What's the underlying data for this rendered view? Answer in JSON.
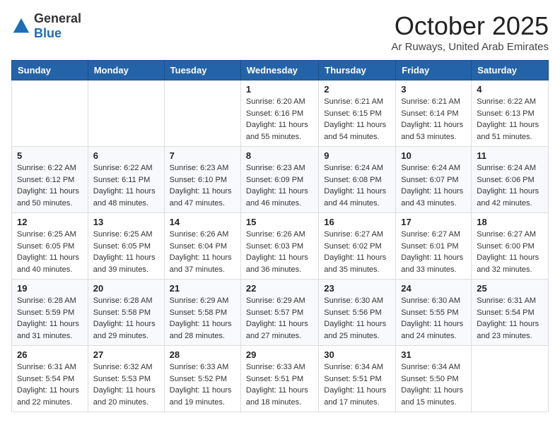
{
  "header": {
    "logo_general": "General",
    "logo_blue": "Blue",
    "month_title": "October 2025",
    "subtitle": "Ar Ruways, United Arab Emirates"
  },
  "weekdays": [
    "Sunday",
    "Monday",
    "Tuesday",
    "Wednesday",
    "Thursday",
    "Friday",
    "Saturday"
  ],
  "weeks": [
    [
      {
        "day": "",
        "sunrise": "",
        "sunset": "",
        "daylight": ""
      },
      {
        "day": "",
        "sunrise": "",
        "sunset": "",
        "daylight": ""
      },
      {
        "day": "",
        "sunrise": "",
        "sunset": "",
        "daylight": ""
      },
      {
        "day": "1",
        "sunrise": "Sunrise: 6:20 AM",
        "sunset": "Sunset: 6:16 PM",
        "daylight": "Daylight: 11 hours and 55 minutes."
      },
      {
        "day": "2",
        "sunrise": "Sunrise: 6:21 AM",
        "sunset": "Sunset: 6:15 PM",
        "daylight": "Daylight: 11 hours and 54 minutes."
      },
      {
        "day": "3",
        "sunrise": "Sunrise: 6:21 AM",
        "sunset": "Sunset: 6:14 PM",
        "daylight": "Daylight: 11 hours and 53 minutes."
      },
      {
        "day": "4",
        "sunrise": "Sunrise: 6:22 AM",
        "sunset": "Sunset: 6:13 PM",
        "daylight": "Daylight: 11 hours and 51 minutes."
      }
    ],
    [
      {
        "day": "5",
        "sunrise": "Sunrise: 6:22 AM",
        "sunset": "Sunset: 6:12 PM",
        "daylight": "Daylight: 11 hours and 50 minutes."
      },
      {
        "day": "6",
        "sunrise": "Sunrise: 6:22 AM",
        "sunset": "Sunset: 6:11 PM",
        "daylight": "Daylight: 11 hours and 48 minutes."
      },
      {
        "day": "7",
        "sunrise": "Sunrise: 6:23 AM",
        "sunset": "Sunset: 6:10 PM",
        "daylight": "Daylight: 11 hours and 47 minutes."
      },
      {
        "day": "8",
        "sunrise": "Sunrise: 6:23 AM",
        "sunset": "Sunset: 6:09 PM",
        "daylight": "Daylight: 11 hours and 46 minutes."
      },
      {
        "day": "9",
        "sunrise": "Sunrise: 6:24 AM",
        "sunset": "Sunset: 6:08 PM",
        "daylight": "Daylight: 11 hours and 44 minutes."
      },
      {
        "day": "10",
        "sunrise": "Sunrise: 6:24 AM",
        "sunset": "Sunset: 6:07 PM",
        "daylight": "Daylight: 11 hours and 43 minutes."
      },
      {
        "day": "11",
        "sunrise": "Sunrise: 6:24 AM",
        "sunset": "Sunset: 6:06 PM",
        "daylight": "Daylight: 11 hours and 42 minutes."
      }
    ],
    [
      {
        "day": "12",
        "sunrise": "Sunrise: 6:25 AM",
        "sunset": "Sunset: 6:05 PM",
        "daylight": "Daylight: 11 hours and 40 minutes."
      },
      {
        "day": "13",
        "sunrise": "Sunrise: 6:25 AM",
        "sunset": "Sunset: 6:05 PM",
        "daylight": "Daylight: 11 hours and 39 minutes."
      },
      {
        "day": "14",
        "sunrise": "Sunrise: 6:26 AM",
        "sunset": "Sunset: 6:04 PM",
        "daylight": "Daylight: 11 hours and 37 minutes."
      },
      {
        "day": "15",
        "sunrise": "Sunrise: 6:26 AM",
        "sunset": "Sunset: 6:03 PM",
        "daylight": "Daylight: 11 hours and 36 minutes."
      },
      {
        "day": "16",
        "sunrise": "Sunrise: 6:27 AM",
        "sunset": "Sunset: 6:02 PM",
        "daylight": "Daylight: 11 hours and 35 minutes."
      },
      {
        "day": "17",
        "sunrise": "Sunrise: 6:27 AM",
        "sunset": "Sunset: 6:01 PM",
        "daylight": "Daylight: 11 hours and 33 minutes."
      },
      {
        "day": "18",
        "sunrise": "Sunrise: 6:27 AM",
        "sunset": "Sunset: 6:00 PM",
        "daylight": "Daylight: 11 hours and 32 minutes."
      }
    ],
    [
      {
        "day": "19",
        "sunrise": "Sunrise: 6:28 AM",
        "sunset": "Sunset: 5:59 PM",
        "daylight": "Daylight: 11 hours and 31 minutes."
      },
      {
        "day": "20",
        "sunrise": "Sunrise: 6:28 AM",
        "sunset": "Sunset: 5:58 PM",
        "daylight": "Daylight: 11 hours and 29 minutes."
      },
      {
        "day": "21",
        "sunrise": "Sunrise: 6:29 AM",
        "sunset": "Sunset: 5:58 PM",
        "daylight": "Daylight: 11 hours and 28 minutes."
      },
      {
        "day": "22",
        "sunrise": "Sunrise: 6:29 AM",
        "sunset": "Sunset: 5:57 PM",
        "daylight": "Daylight: 11 hours and 27 minutes."
      },
      {
        "day": "23",
        "sunrise": "Sunrise: 6:30 AM",
        "sunset": "Sunset: 5:56 PM",
        "daylight": "Daylight: 11 hours and 25 minutes."
      },
      {
        "day": "24",
        "sunrise": "Sunrise: 6:30 AM",
        "sunset": "Sunset: 5:55 PM",
        "daylight": "Daylight: 11 hours and 24 minutes."
      },
      {
        "day": "25",
        "sunrise": "Sunrise: 6:31 AM",
        "sunset": "Sunset: 5:54 PM",
        "daylight": "Daylight: 11 hours and 23 minutes."
      }
    ],
    [
      {
        "day": "26",
        "sunrise": "Sunrise: 6:31 AM",
        "sunset": "Sunset: 5:54 PM",
        "daylight": "Daylight: 11 hours and 22 minutes."
      },
      {
        "day": "27",
        "sunrise": "Sunrise: 6:32 AM",
        "sunset": "Sunset: 5:53 PM",
        "daylight": "Daylight: 11 hours and 20 minutes."
      },
      {
        "day": "28",
        "sunrise": "Sunrise: 6:33 AM",
        "sunset": "Sunset: 5:52 PM",
        "daylight": "Daylight: 11 hours and 19 minutes."
      },
      {
        "day": "29",
        "sunrise": "Sunrise: 6:33 AM",
        "sunset": "Sunset: 5:51 PM",
        "daylight": "Daylight: 11 hours and 18 minutes."
      },
      {
        "day": "30",
        "sunrise": "Sunrise: 6:34 AM",
        "sunset": "Sunset: 5:51 PM",
        "daylight": "Daylight: 11 hours and 17 minutes."
      },
      {
        "day": "31",
        "sunrise": "Sunrise: 6:34 AM",
        "sunset": "Sunset: 5:50 PM",
        "daylight": "Daylight: 11 hours and 15 minutes."
      },
      {
        "day": "",
        "sunrise": "",
        "sunset": "",
        "daylight": ""
      }
    ]
  ]
}
